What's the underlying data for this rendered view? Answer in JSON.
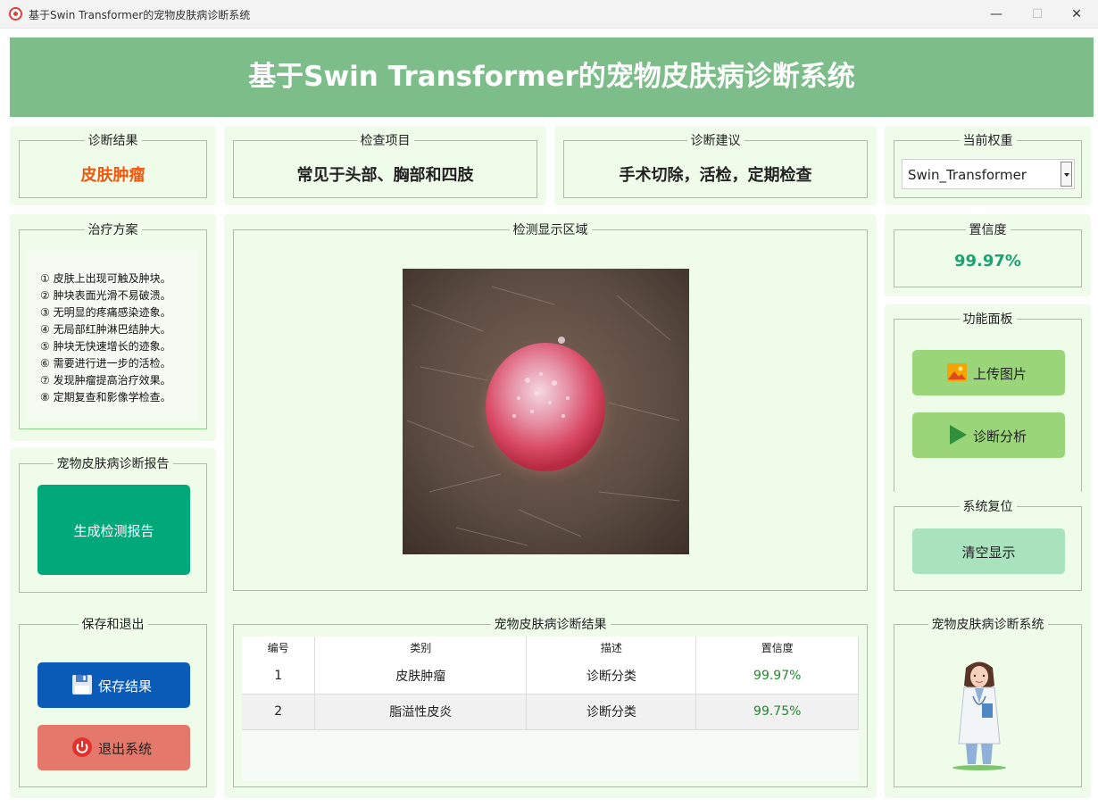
{
  "window": {
    "title": "基于Swin Transformer的宠物皮肤病诊断系统"
  },
  "header": {
    "title": "基于Swin Transformer的宠物皮肤病诊断系统"
  },
  "result": {
    "label": "诊断结果",
    "value": "皮肤肿瘤"
  },
  "exam": {
    "label": "检查项目",
    "value": "常见于头部、胸部和四肢"
  },
  "advice": {
    "label": "诊断建议",
    "value": "手术切除，活检，定期检查"
  },
  "weights": {
    "label": "当前权重",
    "selected": "Swin_Transformer"
  },
  "confidence": {
    "label": "置信度",
    "value": "99.97%"
  },
  "treatment": {
    "label": "治疗方案",
    "items": [
      "① 皮肤上出现可触及肿块。",
      "② 肿块表面光滑不易破溃。",
      "③ 无明显的疼痛感染迹象。",
      "④ 无局部红肿淋巴结肿大。",
      "⑤ 肿块无快速增长的迹象。",
      "⑥ 需要进行进一步的活检。",
      "⑦ 发现肿瘤提高治疗效果。",
      "⑧ 定期复查和影像学检查。"
    ]
  },
  "report": {
    "label": "宠物皮肤病诊断报告",
    "button": "生成检测报告"
  },
  "save_exit": {
    "label": "保存和退出",
    "save_button": "保存结果",
    "exit_button": "退出系统"
  },
  "display": {
    "label": "检测显示区域"
  },
  "function_panel": {
    "label": "功能面板",
    "upload_button": "上传图片",
    "analyze_button": "诊断分析"
  },
  "reset": {
    "label": "系统复位",
    "clear_button": "清空显示"
  },
  "results_table": {
    "label": "宠物皮肤病诊断结果",
    "headers": [
      "编号",
      "类别",
      "描述",
      "置信度"
    ],
    "rows": [
      [
        "1",
        "皮肤肿瘤",
        "诊断分类",
        "99.97%"
      ],
      [
        "2",
        "脂溢性皮炎",
        "诊断分类",
        "99.75%"
      ]
    ]
  },
  "system_box": {
    "label": "宠物皮肤病诊断系统"
  },
  "colors": {
    "header": "#7cbd8a",
    "panel": "#effcea",
    "result_text": "#f0580f",
    "confidence_text": "#1aa274",
    "report_button": "#00a87a",
    "save_button": "#0a5bb8",
    "exit_button": "#e4786b",
    "function_button": "#9ad579",
    "clear_button": "#a8e3bd"
  }
}
